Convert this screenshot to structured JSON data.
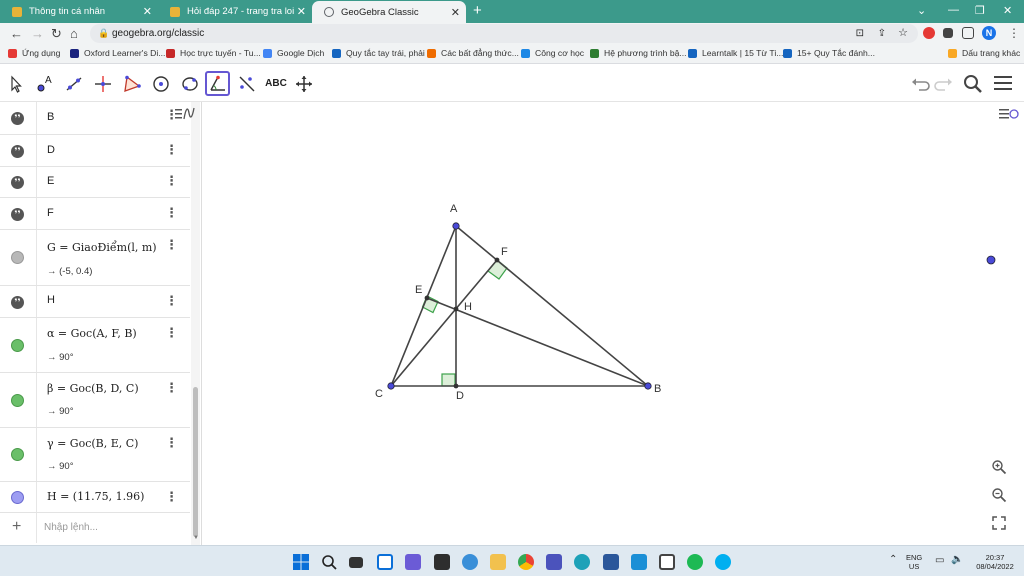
{
  "browser": {
    "tabs": [
      {
        "title": "Thông tin cá nhân",
        "fav": "#e8b339"
      },
      {
        "title": "Hỏi đáp 247 - trang tra loi",
        "fav": "#e8b339"
      },
      {
        "title": "GeoGebra Classic",
        "fav": "#5f6368"
      }
    ],
    "new_tab_icon": "+",
    "url": "geogebra.org/classic",
    "profile_initial": "N",
    "bookmarks": [
      {
        "label": "Ứng dụng",
        "color": "#e53935"
      },
      {
        "label": "Oxford Learner's Di...",
        "color": "#1a237e"
      },
      {
        "label": "Học trực tuyến - Tu...",
        "color": "#c62828"
      },
      {
        "label": "Google Dịch",
        "color": "#4285f4"
      },
      {
        "label": "Quy tắc tay trái, phải",
        "color": "#1565c0"
      },
      {
        "label": "Các bất đẳng thức...",
        "color": "#ef6c00"
      },
      {
        "label": "Công cơ học",
        "color": "#1e88e5"
      },
      {
        "label": "Hệ phương trình bậ...",
        "color": "#2e7d32"
      },
      {
        "label": "Learntalk | 15 Từ Ti...",
        "color": "#1565c0"
      },
      {
        "label": "15+ Quy Tắc đánh...",
        "color": "#1565c0"
      },
      {
        "label": "Dấu trang khác",
        "color": "#f9a825"
      }
    ]
  },
  "toolbar": {
    "text_tool_label": "ABC",
    "icons": [
      "move-tool",
      "point-tool",
      "line-tool",
      "perpendicular-tool",
      "polygon-tool",
      "circle-tool",
      "circle-3pt-tool",
      "angle-tool",
      "reflect-tool",
      "text-tool",
      "move-graphics-tool"
    ]
  },
  "algebra": {
    "rows": [
      {
        "id": "B",
        "text": "B",
        "bullet": "quote"
      },
      {
        "id": "D",
        "text": "D",
        "bullet": "quote"
      },
      {
        "id": "E",
        "text": "E",
        "bullet": "quote"
      },
      {
        "id": "F",
        "text": "F",
        "bullet": "quote"
      },
      {
        "id": "G",
        "text": "G = GiaoĐiểm(l, m)",
        "result": "→  (-5, 0.4)",
        "bullet": "#b8b8b8"
      },
      {
        "id": "H",
        "text": "H",
        "bullet": "quote"
      },
      {
        "id": "alpha",
        "text": "α = Goc(A, F, B)",
        "result": "→  90°",
        "bullet": "#6abf69"
      },
      {
        "id": "beta",
        "text": "β = Goc(B, D, C)",
        "result": "→  90°",
        "bullet": "#6abf69"
      },
      {
        "id": "gamma",
        "text": "γ = Goc(B, E, C)",
        "result": "→  90°",
        "bullet": "#6abf69"
      },
      {
        "id": "Hval",
        "text": "H = (11.75, 1.96)",
        "bullet": "#9d9df2"
      }
    ],
    "input_placeholder": "Nhập lệnh..."
  },
  "geometry": {
    "labels": {
      "A": "A",
      "B": "B",
      "C": "C",
      "D": "D",
      "E": "E",
      "F": "F",
      "H": "H"
    }
  },
  "taskbar": {
    "lang": "ENG",
    "region": "US",
    "time": "20:37",
    "date": "08/04/2022"
  },
  "colors": {
    "accent": "#6557d2",
    "point": "#4a4ad8",
    "angle": "#3da24b",
    "tab_bar": "#3c9a8b"
  }
}
